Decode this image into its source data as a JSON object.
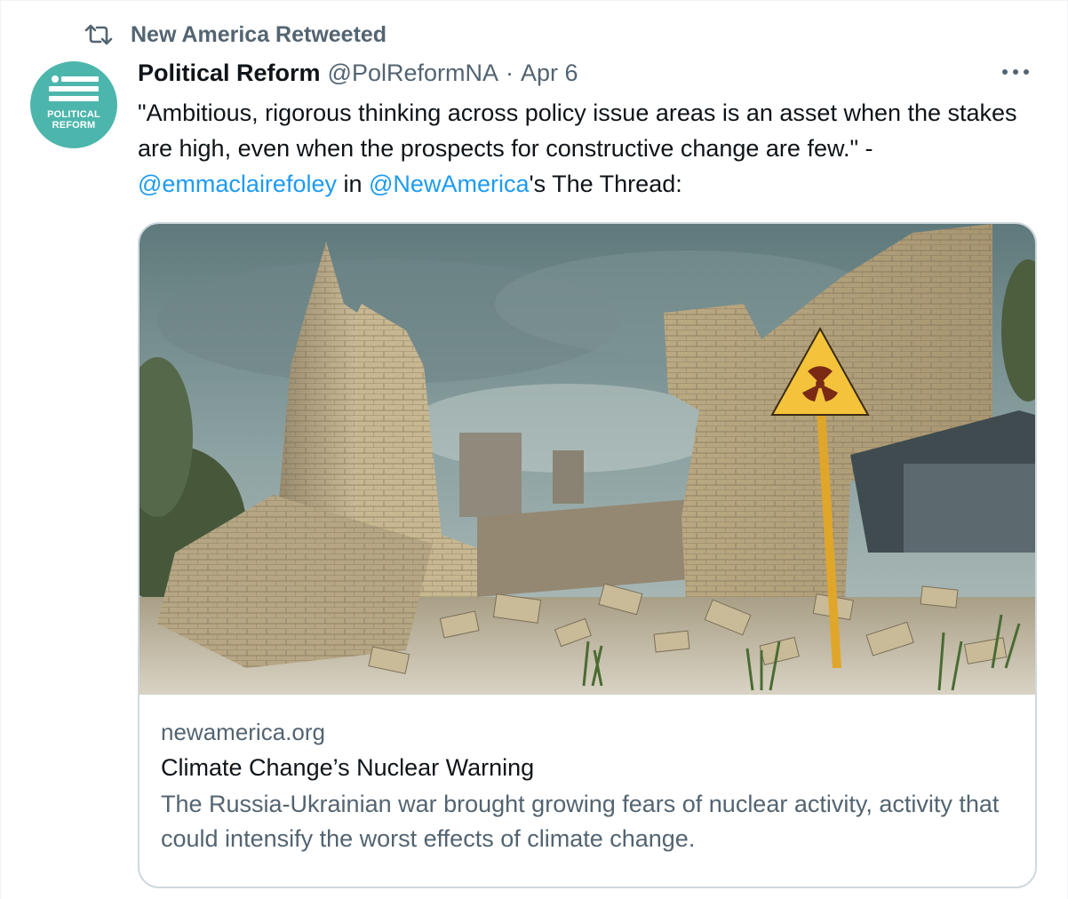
{
  "social_context": {
    "icon": "retweet-icon",
    "text": "New America Retweeted"
  },
  "author": {
    "avatar_text": "POLITICAL REFORM",
    "avatar_color": "#4db6ac",
    "display_name": "Political Reform",
    "handle": "@PolReformNA",
    "separator": "·",
    "date": "Apr 6"
  },
  "menu": {
    "icon": "more-options-icon"
  },
  "tweet": {
    "text_part1": "\"Ambitious, rigorous thinking across policy issue areas is an asset when the stakes are high, even when the prospects for constructive change are few.\" -",
    "mention1": "@emmaclairefoley",
    "text_part2": " in ",
    "mention2": "@NewAmerica",
    "text_part3": "'s The Thread:"
  },
  "card": {
    "image_alt": "Ruined brick building with a yellow radiation warning sign in the foreground",
    "domain": "newamerica.org",
    "title": "Climate Change’s Nuclear Warning",
    "description": "The Russia-Ukrainian war brought growing fears of nuclear activity, activity that could intensify the worst effects of climate change."
  },
  "colors": {
    "link": "#1d9bf0",
    "secondary_text": "#536471",
    "primary_text": "#0f1419",
    "card_border": "#cfd9de"
  }
}
